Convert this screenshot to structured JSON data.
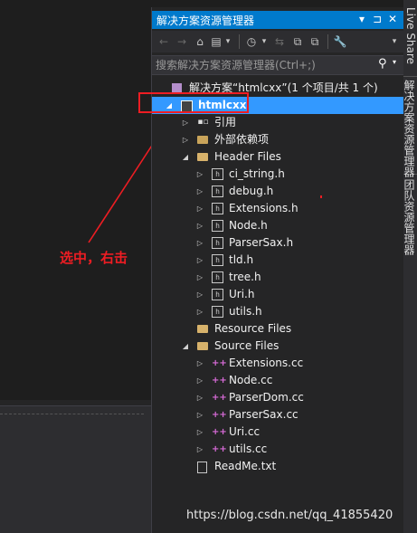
{
  "annotation": {
    "note": "选中，右击",
    "color": "#ee1d23"
  },
  "solution_explorer": {
    "title": "解决方案资源管理器",
    "title_buttons": [
      "▾",
      "⊐",
      "✕"
    ],
    "toolbar": {
      "back_icon": "←",
      "forward_icon": "→",
      "home_icon": "⌂",
      "switch_view_icon": "▤",
      "history_icon": "◷",
      "sync_icon": "⇆",
      "collapse_icon": "⧉",
      "show_all_icon": "⧉",
      "properties_icon": "🔧",
      "dropdown_icon": "▾"
    },
    "search": {
      "placeholder": "搜索解决方案资源管理器(Ctrl+;)",
      "icon": "⚲",
      "dropdown": "▾"
    },
    "tree": [
      {
        "label": "解决方案“htmlcxx”(1 个项目/共 1 个)",
        "icon": "solution",
        "expander": "",
        "indent": 0
      },
      {
        "label": "htmlcxx",
        "icon": "project",
        "expander": "◢",
        "indent": 1,
        "selected": true
      },
      {
        "label": "引用",
        "icon": "references",
        "expander": "▷",
        "indent": 2
      },
      {
        "label": "外部依赖项",
        "icon": "folder",
        "expander": "▷",
        "indent": 2
      },
      {
        "label": "Header Files",
        "icon": "folder",
        "expander": "◢",
        "indent": 2
      },
      {
        "label": "ci_string.h",
        "icon": "h",
        "expander": "▷",
        "indent": 3
      },
      {
        "label": "debug.h",
        "icon": "h",
        "expander": "▷",
        "indent": 3
      },
      {
        "label": "Extensions.h",
        "icon": "h",
        "expander": "▷",
        "indent": 3
      },
      {
        "label": "Node.h",
        "icon": "h",
        "expander": "▷",
        "indent": 3
      },
      {
        "label": "ParserSax.h",
        "icon": "h",
        "expander": "▷",
        "indent": 3
      },
      {
        "label": "tld.h",
        "icon": "h",
        "expander": "▷",
        "indent": 3
      },
      {
        "label": "tree.h",
        "icon": "h",
        "expander": "▷",
        "indent": 3
      },
      {
        "label": "Uri.h",
        "icon": "h",
        "expander": "▷",
        "indent": 3
      },
      {
        "label": "utils.h",
        "icon": "h",
        "expander": "▷",
        "indent": 3
      },
      {
        "label": "Resource Files",
        "icon": "folder",
        "expander": "",
        "indent": 2
      },
      {
        "label": "Source Files",
        "icon": "folder",
        "expander": "◢",
        "indent": 2
      },
      {
        "label": "Extensions.cc",
        "icon": "cc",
        "expander": "▷",
        "indent": 3
      },
      {
        "label": "Node.cc",
        "icon": "cc",
        "expander": "▷",
        "indent": 3
      },
      {
        "label": "ParserDom.cc",
        "icon": "cc",
        "expander": "▷",
        "indent": 3
      },
      {
        "label": "ParserSax.cc",
        "icon": "cc",
        "expander": "▷",
        "indent": 3
      },
      {
        "label": "Uri.cc",
        "icon": "cc",
        "expander": "▷",
        "indent": 3
      },
      {
        "label": "utils.cc",
        "icon": "cc",
        "expander": "▷",
        "indent": 3
      },
      {
        "label": "ReadMe.txt",
        "icon": "txt",
        "expander": "",
        "indent": 2
      }
    ]
  },
  "side_tabs": [
    "Live Share",
    "解决方案资源管理器",
    "团队资源管理器"
  ],
  "watermark": "https://blog.csdn.net/qq_41855420"
}
